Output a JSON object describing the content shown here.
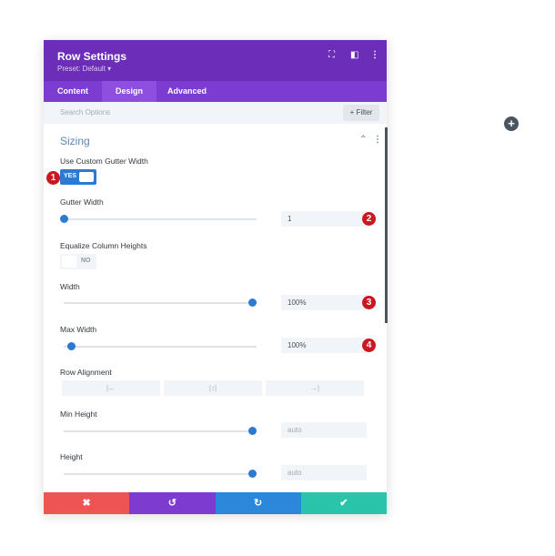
{
  "header": {
    "title": "Row Settings",
    "preset": "Preset: Default ▾",
    "icons": [
      "fullscreen-icon",
      "sidebar-icon",
      "more-icon"
    ]
  },
  "tabs": [
    {
      "label": "Content"
    },
    {
      "label": "Design",
      "active": true
    },
    {
      "label": "Advanced"
    }
  ],
  "search": {
    "placeholder": "Search Options",
    "filter_label": "+ Filter"
  },
  "section": {
    "title": "Sizing"
  },
  "fields": {
    "custom_gutter": {
      "label": "Use Custom Gutter Width",
      "value": "YES",
      "badge": "1"
    },
    "gutter_width": {
      "label": "Gutter Width",
      "value": "1",
      "slider_fraction": 0,
      "badge": "2"
    },
    "equalize": {
      "label": "Equalize Column Heights",
      "value": "NO"
    },
    "width": {
      "label": "Width",
      "value": "100%",
      "slider_fraction": 1,
      "badge": "3"
    },
    "max_width": {
      "label": "Max Width",
      "value": "100%",
      "slider_fraction": 0.04,
      "badge": "4"
    },
    "row_alignment": {
      "label": "Row Alignment",
      "options": [
        "|←",
        "|↕|",
        "→|"
      ]
    },
    "min_height": {
      "label": "Min Height",
      "placeholder": "auto",
      "slider_fraction": 1
    },
    "height": {
      "label": "Height",
      "placeholder": "auto",
      "slider_fraction": 1
    }
  },
  "footer": {
    "cancel": "✖",
    "undo": "↺",
    "redo": "↻",
    "save": "✔"
  },
  "colors": {
    "header": "#6c2eb9",
    "tabs": "#7c3bd1",
    "accent": "#2d7bd1",
    "cancel": "#ef5454",
    "undo": "#7d3bcf",
    "redo": "#2b87da",
    "save": "#29c4a9",
    "badge": "#c9181f"
  },
  "add_button": "+"
}
